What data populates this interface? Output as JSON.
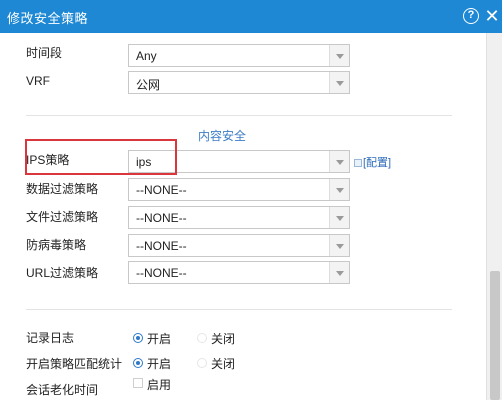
{
  "dialog": {
    "title": "修改安全策略",
    "help_icon": "question-circle-icon",
    "help_glyph": "?",
    "close_glyph": "✕",
    "close_icon": "close-icon"
  },
  "basic": {
    "time_period_label": "时间段",
    "time_period_value": "Any",
    "vrf_label": "VRF",
    "vrf_value": "公网"
  },
  "content_security": {
    "section_title": "内容安全",
    "ips_label": "IPS策略",
    "ips_value": "ips",
    "config_link": "[配置]",
    "data_filter_label": "数据过滤策略",
    "data_filter_value": "--NONE--",
    "file_filter_label": "文件过滤策略",
    "file_filter_value": "--NONE--",
    "antivirus_label": "防病毒策略",
    "antivirus_value": "--NONE--",
    "url_filter_label": "URL过滤策略",
    "url_filter_value": "--NONE--"
  },
  "options": {
    "log_label": "记录日志",
    "log_on": "开启",
    "log_off": "关闭",
    "match_stats_label": "开启策略匹配统计",
    "match_on": "开启",
    "match_off": "关闭",
    "session_aging_label": "会话老化时间",
    "session_aging_enable": "启用"
  },
  "colors": {
    "titlebar": "#1f88d4",
    "highlight": "#d9363e",
    "section_title": "#3d7ec7"
  }
}
